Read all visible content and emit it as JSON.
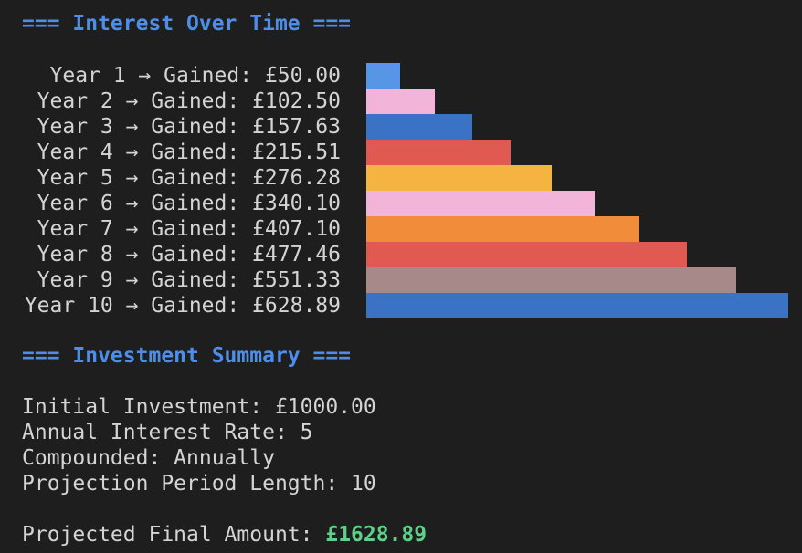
{
  "interest_heading": "=== Interest Over Time ===",
  "summary_heading": "=== Investment Summary ===",
  "chart_data": {
    "type": "bar",
    "orientation": "horizontal",
    "categories": [
      "Year 1",
      "Year 2",
      "Year 3",
      "Year 4",
      "Year 5",
      "Year 6",
      "Year 7",
      "Year 8",
      "Year 9",
      "Year 10"
    ],
    "values": [
      50.0,
      102.5,
      157.63,
      215.51,
      276.28,
      340.1,
      407.1,
      477.46,
      551.33,
      628.89
    ],
    "labels": [
      "Year 1 → Gained: £50.00",
      "Year 2 → Gained: £102.50",
      "Year 3 → Gained: £157.63",
      "Year 4 → Gained: £215.51",
      "Year 5 → Gained: £276.28",
      "Year 6 → Gained: £340.10",
      "Year 7 → Gained: £407.10",
      "Year 8 → Gained: £477.46",
      "Year 9 → Gained: £551.33",
      "Year 10 → Gained: £628.89"
    ],
    "colors": [
      "#5795e6",
      "#f2b5d9",
      "#3a72c6",
      "#e05a52",
      "#f5b342",
      "#f2b5d9",
      "#f08c3a",
      "#e05a52",
      "#a8898a",
      "#3a72c6"
    ]
  },
  "summary": {
    "initial_investment": "Initial Investment: £1000.00",
    "annual_rate": "Annual Interest Rate: 5",
    "compounded": "Compounded: Annually",
    "period_length": "Projection Period Length: 10",
    "final_label": "Projected Final Amount: ",
    "final_value": "£1628.89"
  }
}
